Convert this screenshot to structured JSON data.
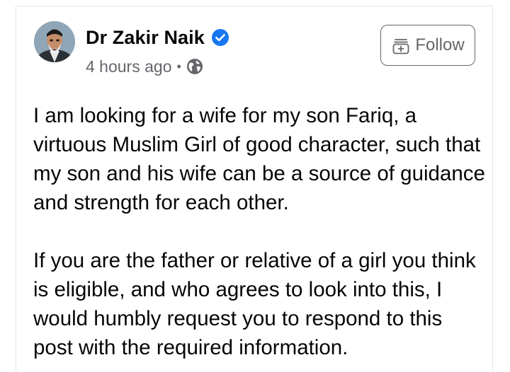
{
  "post": {
    "author": {
      "name": "Dr Zakir Naik",
      "verified": true,
      "avatar_icon": "profile-photo"
    },
    "timestamp": "4 hours ago",
    "separator": "•",
    "privacy_icon": "globe-icon",
    "follow_label": "Follow",
    "body": {
      "paragraph_1": "I am looking for a wife for my son Fariq, a virtuous Muslim Girl of good character, such that my son and his wife can be a source of guidance and strength for each other.",
      "paragraph_2": "If you are the father or relative of a girl you think is eligible, and who agrees to look into this, I would humbly request you to respond to this post with the required information."
    }
  },
  "colors": {
    "text_primary": "#050505",
    "text_secondary": "#65676b",
    "verified_blue": "#1877f2",
    "card_border": "#e4e6eb"
  }
}
